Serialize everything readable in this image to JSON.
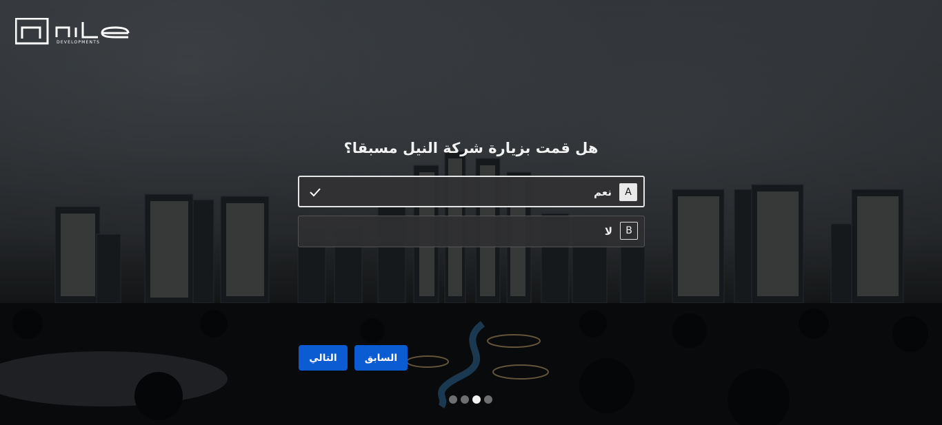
{
  "brand": {
    "name": "nile",
    "tagline": "DEVELOPMENTS"
  },
  "question": {
    "text": "هل قمت بزيارة شركة النيل مسبقا؟"
  },
  "options": [
    {
      "key": "A",
      "label": "نعم",
      "selected": true
    },
    {
      "key": "B",
      "label": "لا",
      "selected": false
    }
  ],
  "buttons": {
    "next_label": "التالي",
    "prev_label": "السابق"
  },
  "pagination": {
    "total": 4,
    "active_index": 2
  },
  "colors": {
    "accent": "#0b5bd3",
    "text": "#f2f2f2"
  }
}
